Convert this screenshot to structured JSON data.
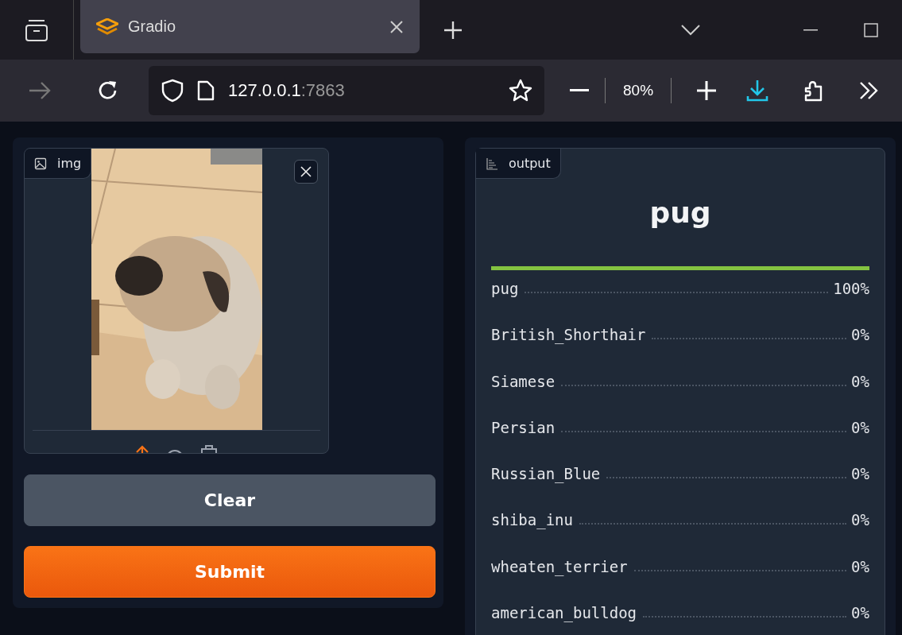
{
  "browser": {
    "tab": {
      "title": "Gradio",
      "selected": true
    },
    "url": {
      "host": "127.0.0.1",
      "port": ":7863"
    },
    "zoom": "80%"
  },
  "input": {
    "label": "img"
  },
  "buttons": [
    {
      "label": "Clear",
      "kind": "secondary"
    },
    {
      "label": "Submit",
      "kind": "primary"
    }
  ],
  "output": {
    "label": "output",
    "prediction": "pug",
    "confidences": [
      {
        "label": "pug",
        "value": "100%",
        "level": 1
      },
      {
        "label": "British_Shorthair",
        "value": "0%"
      },
      {
        "label": "Siamese",
        "value": "0%"
      },
      {
        "label": "Persian",
        "value": "0%"
      },
      {
        "label": "Russian_Blue",
        "value": "0%"
      },
      {
        "label": "shiba_inu",
        "value": "0%"
      },
      {
        "label": "wheaten_terrier",
        "value": "0%"
      },
      {
        "label": "american_bulldog",
        "value": "0%"
      }
    ]
  }
}
